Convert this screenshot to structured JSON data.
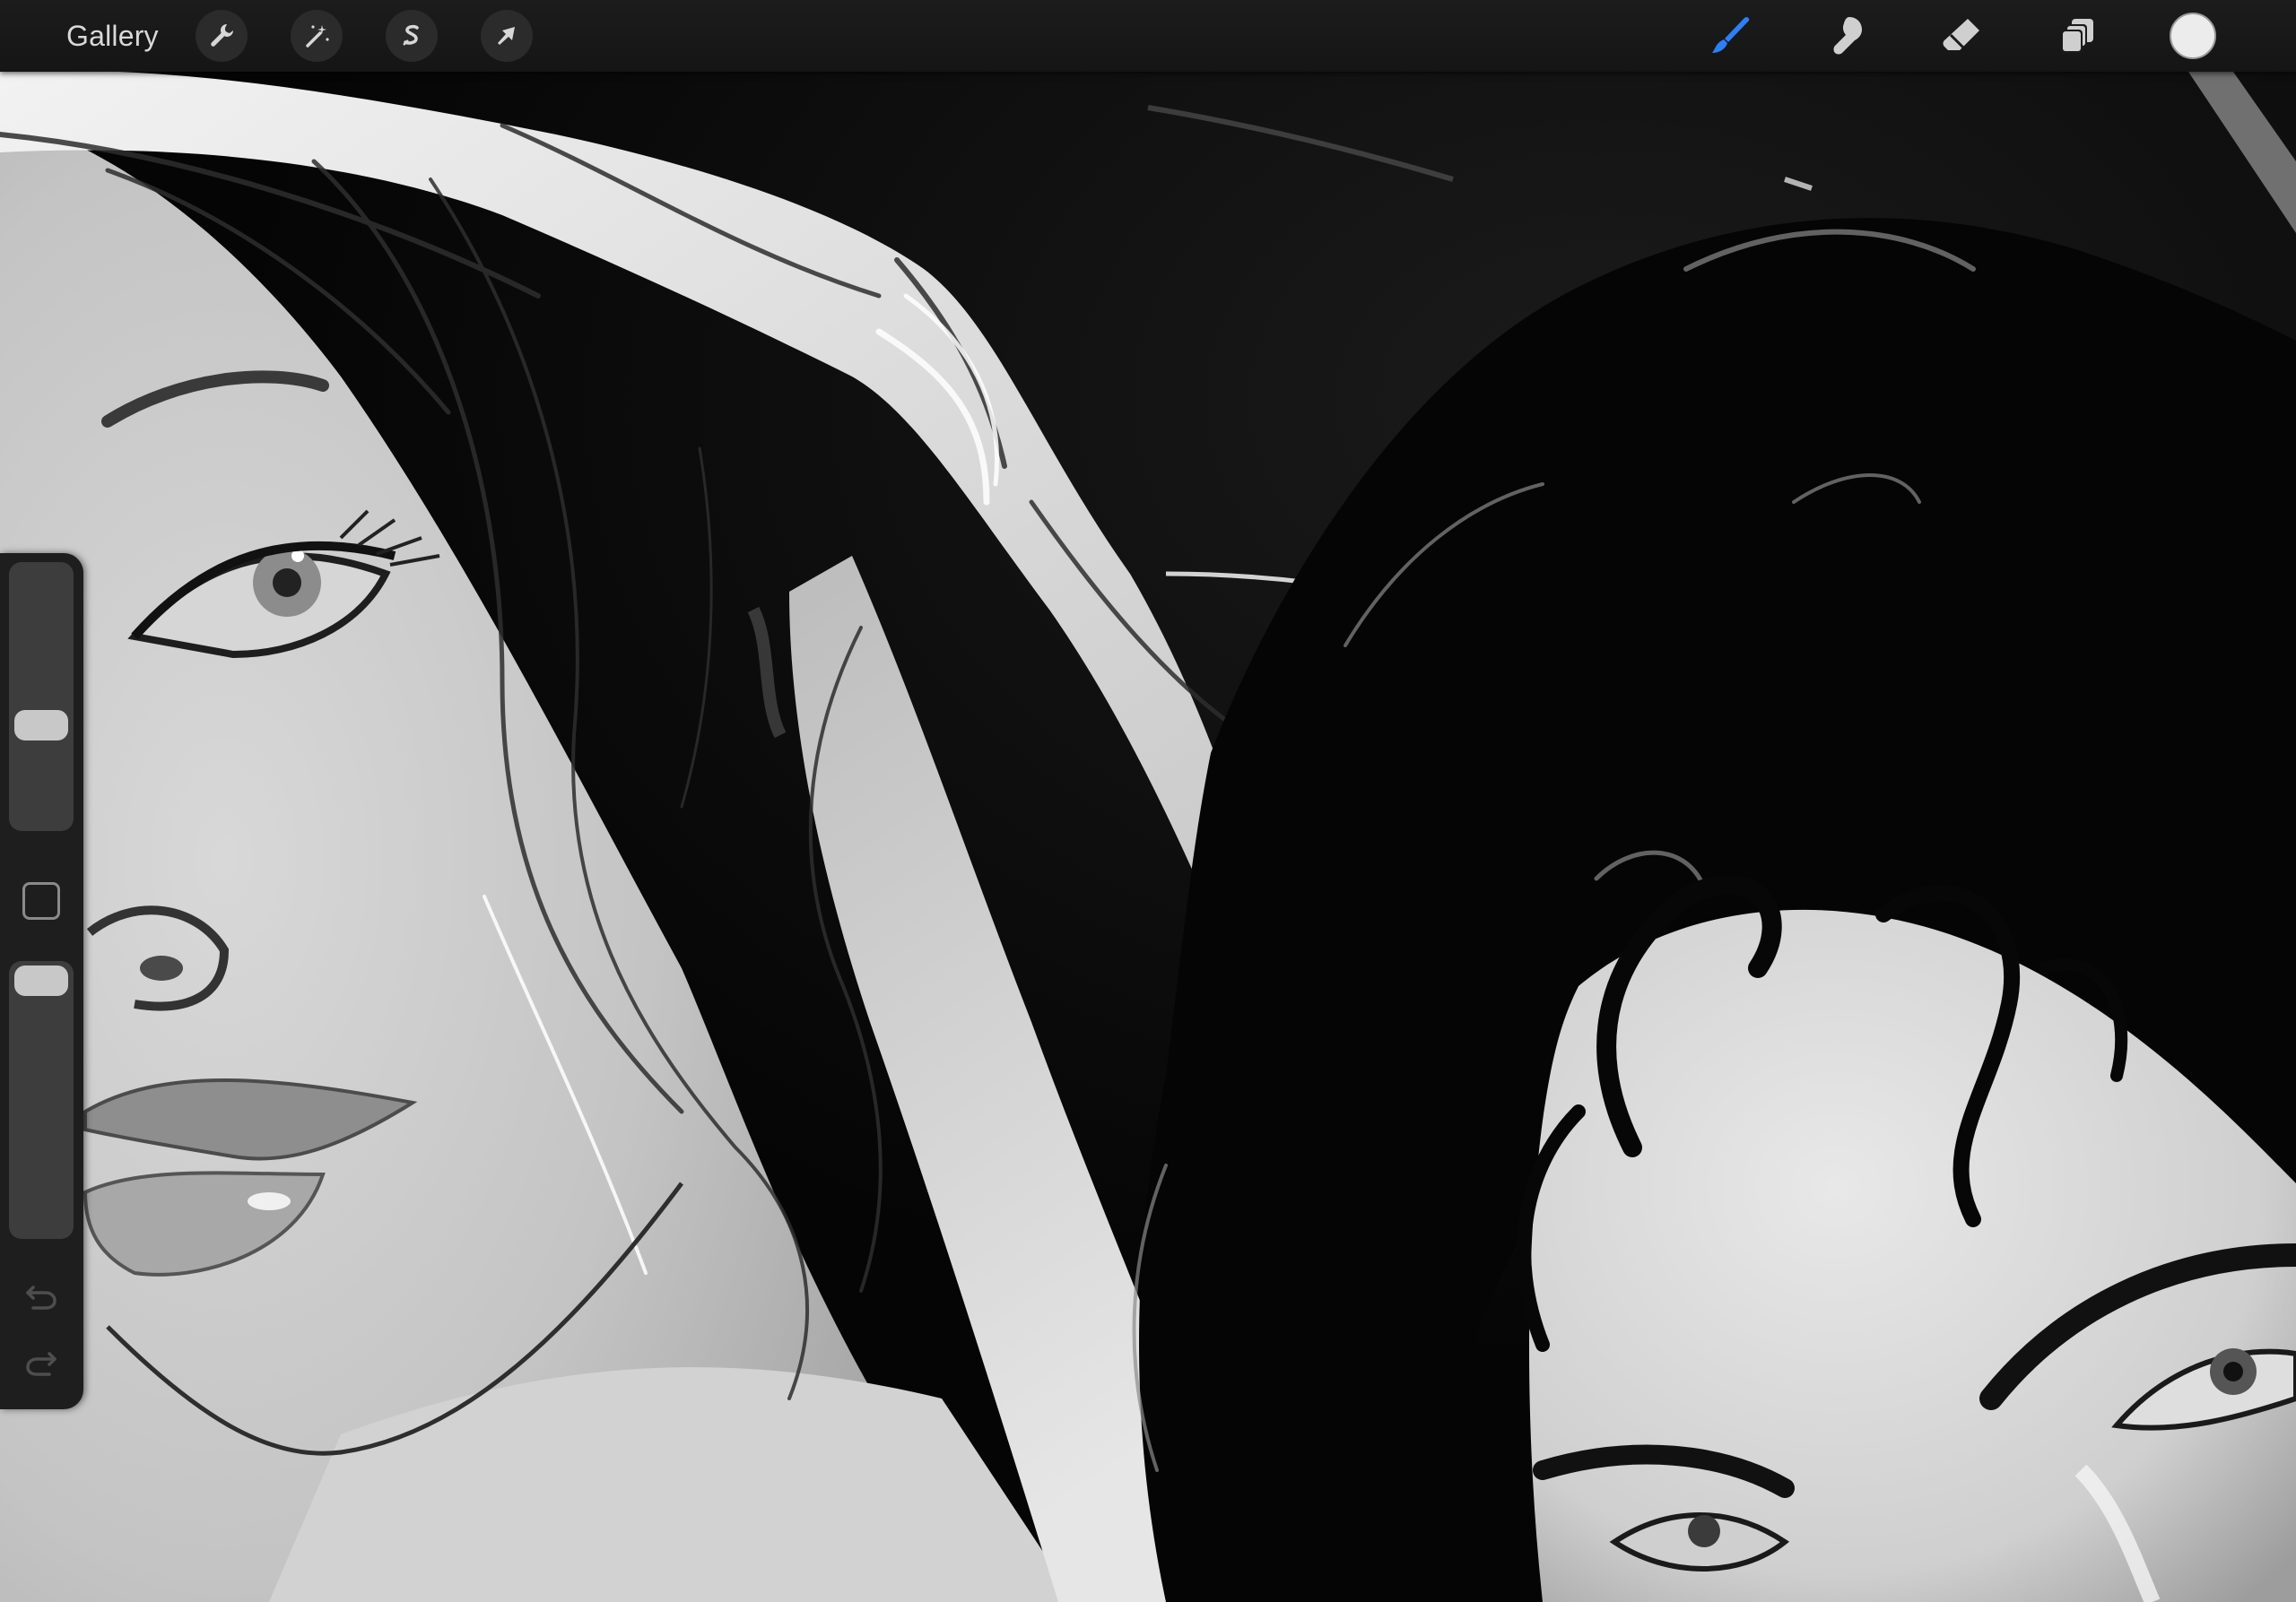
{
  "toolbar": {
    "gallery_label": "Gallery",
    "left_tools": [
      {
        "name": "actions",
        "icon": "wrench-icon"
      },
      {
        "name": "adjustments",
        "icon": "magic-wand-icon"
      },
      {
        "name": "selection",
        "icon": "selection-s-icon"
      },
      {
        "name": "transform",
        "icon": "arrow-cursor-icon"
      }
    ],
    "right_tools": [
      {
        "name": "brush",
        "icon": "brush-icon",
        "active": true
      },
      {
        "name": "smudge",
        "icon": "smudge-finger-icon",
        "active": false
      },
      {
        "name": "eraser",
        "icon": "eraser-icon",
        "active": false
      },
      {
        "name": "layers",
        "icon": "layers-icon",
        "active": false
      }
    ],
    "current_color": "#ececec",
    "accent_color": "#2d7ff9"
  },
  "sidebar": {
    "brush_size_level": 0.55,
    "opacity_level": 0.95,
    "modify_button_icon": "square-outline-icon",
    "undo_icon": "undo-icon",
    "redo_icon": "redo-icon"
  },
  "canvas": {
    "description_free": true,
    "background_color": "#060606"
  }
}
